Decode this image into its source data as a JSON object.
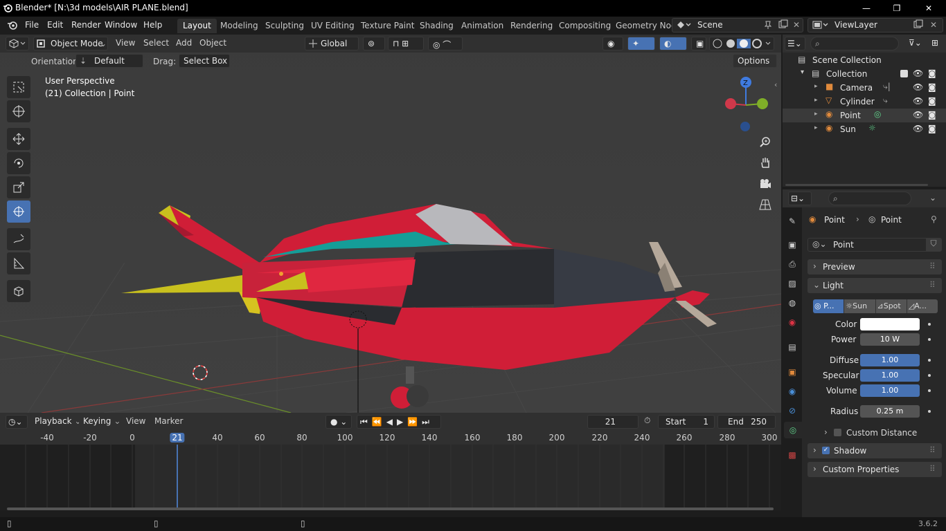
{
  "window": {
    "title": "Blender* [N:\\3d models\\AIR PLANE.blend]",
    "minimize": "—",
    "maximize": "❐",
    "close": "✕"
  },
  "menu": {
    "file": "File",
    "edit": "Edit",
    "render": "Render",
    "window": "Window",
    "help": "Help"
  },
  "workspaces": [
    "Layout",
    "Modeling",
    "Sculpting",
    "UV Editing",
    "Texture Paint",
    "Shading",
    "Animation",
    "Rendering",
    "Compositing",
    "Geometry Noc"
  ],
  "scene": "Scene",
  "view_layer": "ViewLayer",
  "viewport": {
    "mode": "Object Mode",
    "menu_view": "View",
    "menu_select": "Select",
    "menu_add": "Add",
    "menu_object": "Object",
    "transform_orientation": "Global",
    "orientation_label": "Orientation:",
    "orientation_value": "Default",
    "drag_label": "Drag:",
    "drag_value": "Select Box",
    "options": "Options",
    "perspective": "User Perspective",
    "context": "(21) Collection | Point",
    "gizmo": {
      "x": "X",
      "y": "Y",
      "z": "Z"
    },
    "colors": {
      "bg": "#3d3d3d",
      "plane_red": "#d01e37",
      "teal": "#159d98",
      "dark": "#2a2c30",
      "yellow": "#c8c01e"
    }
  },
  "timeline": {
    "playback": "Playback",
    "keying": "Keying",
    "view": "View",
    "marker": "Marker",
    "current_frame": "21",
    "start_label": "Start",
    "start": "1",
    "end_label": "End",
    "end": "250",
    "ruler": [
      "-40",
      "-20",
      "0",
      "21",
      "40",
      "60",
      "80",
      "100",
      "120",
      "140",
      "160",
      "180",
      "200",
      "220",
      "240",
      "260",
      "280",
      "300"
    ]
  },
  "outliner": {
    "scene_collection": "Scene Collection",
    "collection": "Collection",
    "items": [
      "Camera",
      "Cylinder",
      "Point",
      "Sun"
    ]
  },
  "properties": {
    "breadcrumb_object": "Point",
    "breadcrumb_data": "Point",
    "datablock": "Point",
    "preview": "Preview",
    "light": "Light",
    "light_types": [
      "P...",
      "Sun",
      "Spot",
      "A..."
    ],
    "color_label": "Color",
    "color_value": "#ffffff",
    "power_label": "Power",
    "power": "10 W",
    "diffuse_label": "Diffuse",
    "diffuse": "1.00",
    "specular_label": "Specular",
    "specular": "1.00",
    "volume_label": "Volume",
    "volume": "1.00",
    "radius_label": "Radius",
    "radius": "0.25 m",
    "custom_distance": "Custom Distance",
    "shadow": "Shadow",
    "custom_properties": "Custom Properties"
  },
  "version": "3.6.2"
}
